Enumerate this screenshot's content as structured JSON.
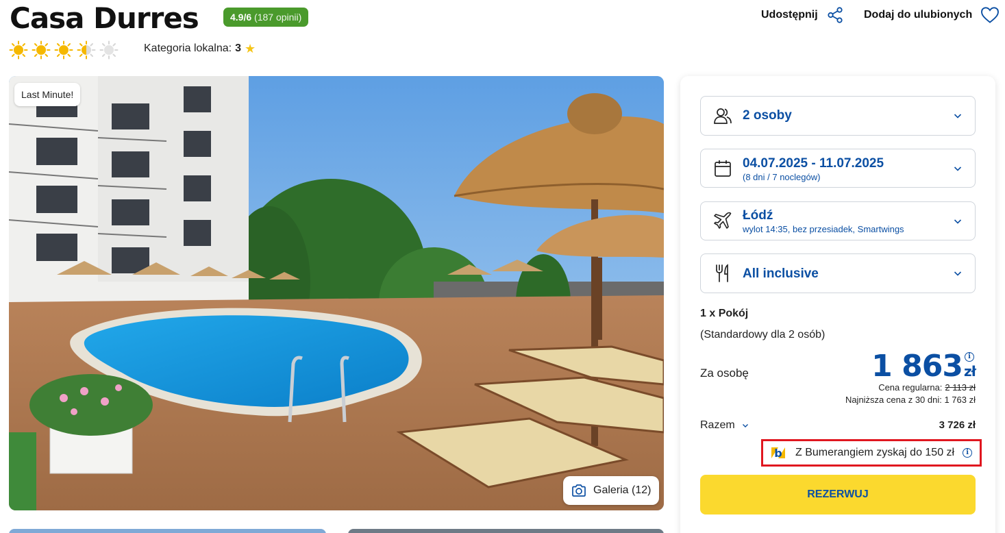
{
  "header": {
    "title": "Casa Durres",
    "rating_score": "4.9/6",
    "rating_reviews": "(187 opinii)",
    "suns": {
      "full": 3,
      "half": 1,
      "empty": 1
    },
    "category_label": "Kategoria lokalna:",
    "category_value": "3",
    "share_label": "Udostępnij",
    "favorite_label": "Dodaj do ulubionych"
  },
  "photo": {
    "badge": "Last Minute!",
    "gallery_label": "Galeria (12)"
  },
  "booking": {
    "persons": "2 osoby",
    "dates": "04.07.2025 - 11.07.2025",
    "dates_sub": "(8 dni / 7 noclegów)",
    "departure": "Łódź",
    "departure_sub": "wylot 14:35, bez przesiadek, Smartwings",
    "board": "All inclusive",
    "room_title": "1 x Pokój",
    "room_desc": "(Standardowy dla 2 osób)",
    "per_person_label": "Za osobę",
    "price": "1 863",
    "currency": "zł",
    "regular_label": "Cena regularna:",
    "regular_price": "2 113 zł",
    "lowest_label": "Najniższa cena z 30 dni: 1 763 zł",
    "total_label": "Razem",
    "total_value": "3 726 zł",
    "bumerang_text": "Z Bumerangiem zyskaj do 150 zł",
    "reserve_label": "REZERWUJ"
  },
  "colors": {
    "accent_blue": "#0b4fa3",
    "rating_green": "#4a9a2c",
    "cta_yellow": "#fbd92e",
    "highlight_red": "#e0161f",
    "sun": "#f5b800"
  },
  "icons": [
    "share-icon",
    "heart-icon",
    "sun-icon",
    "star-icon",
    "camera-icon",
    "users-icon",
    "calendar-icon",
    "plane-icon",
    "cutlery-icon",
    "chevron-down-icon",
    "info-icon",
    "bumerang-logo-icon"
  ]
}
